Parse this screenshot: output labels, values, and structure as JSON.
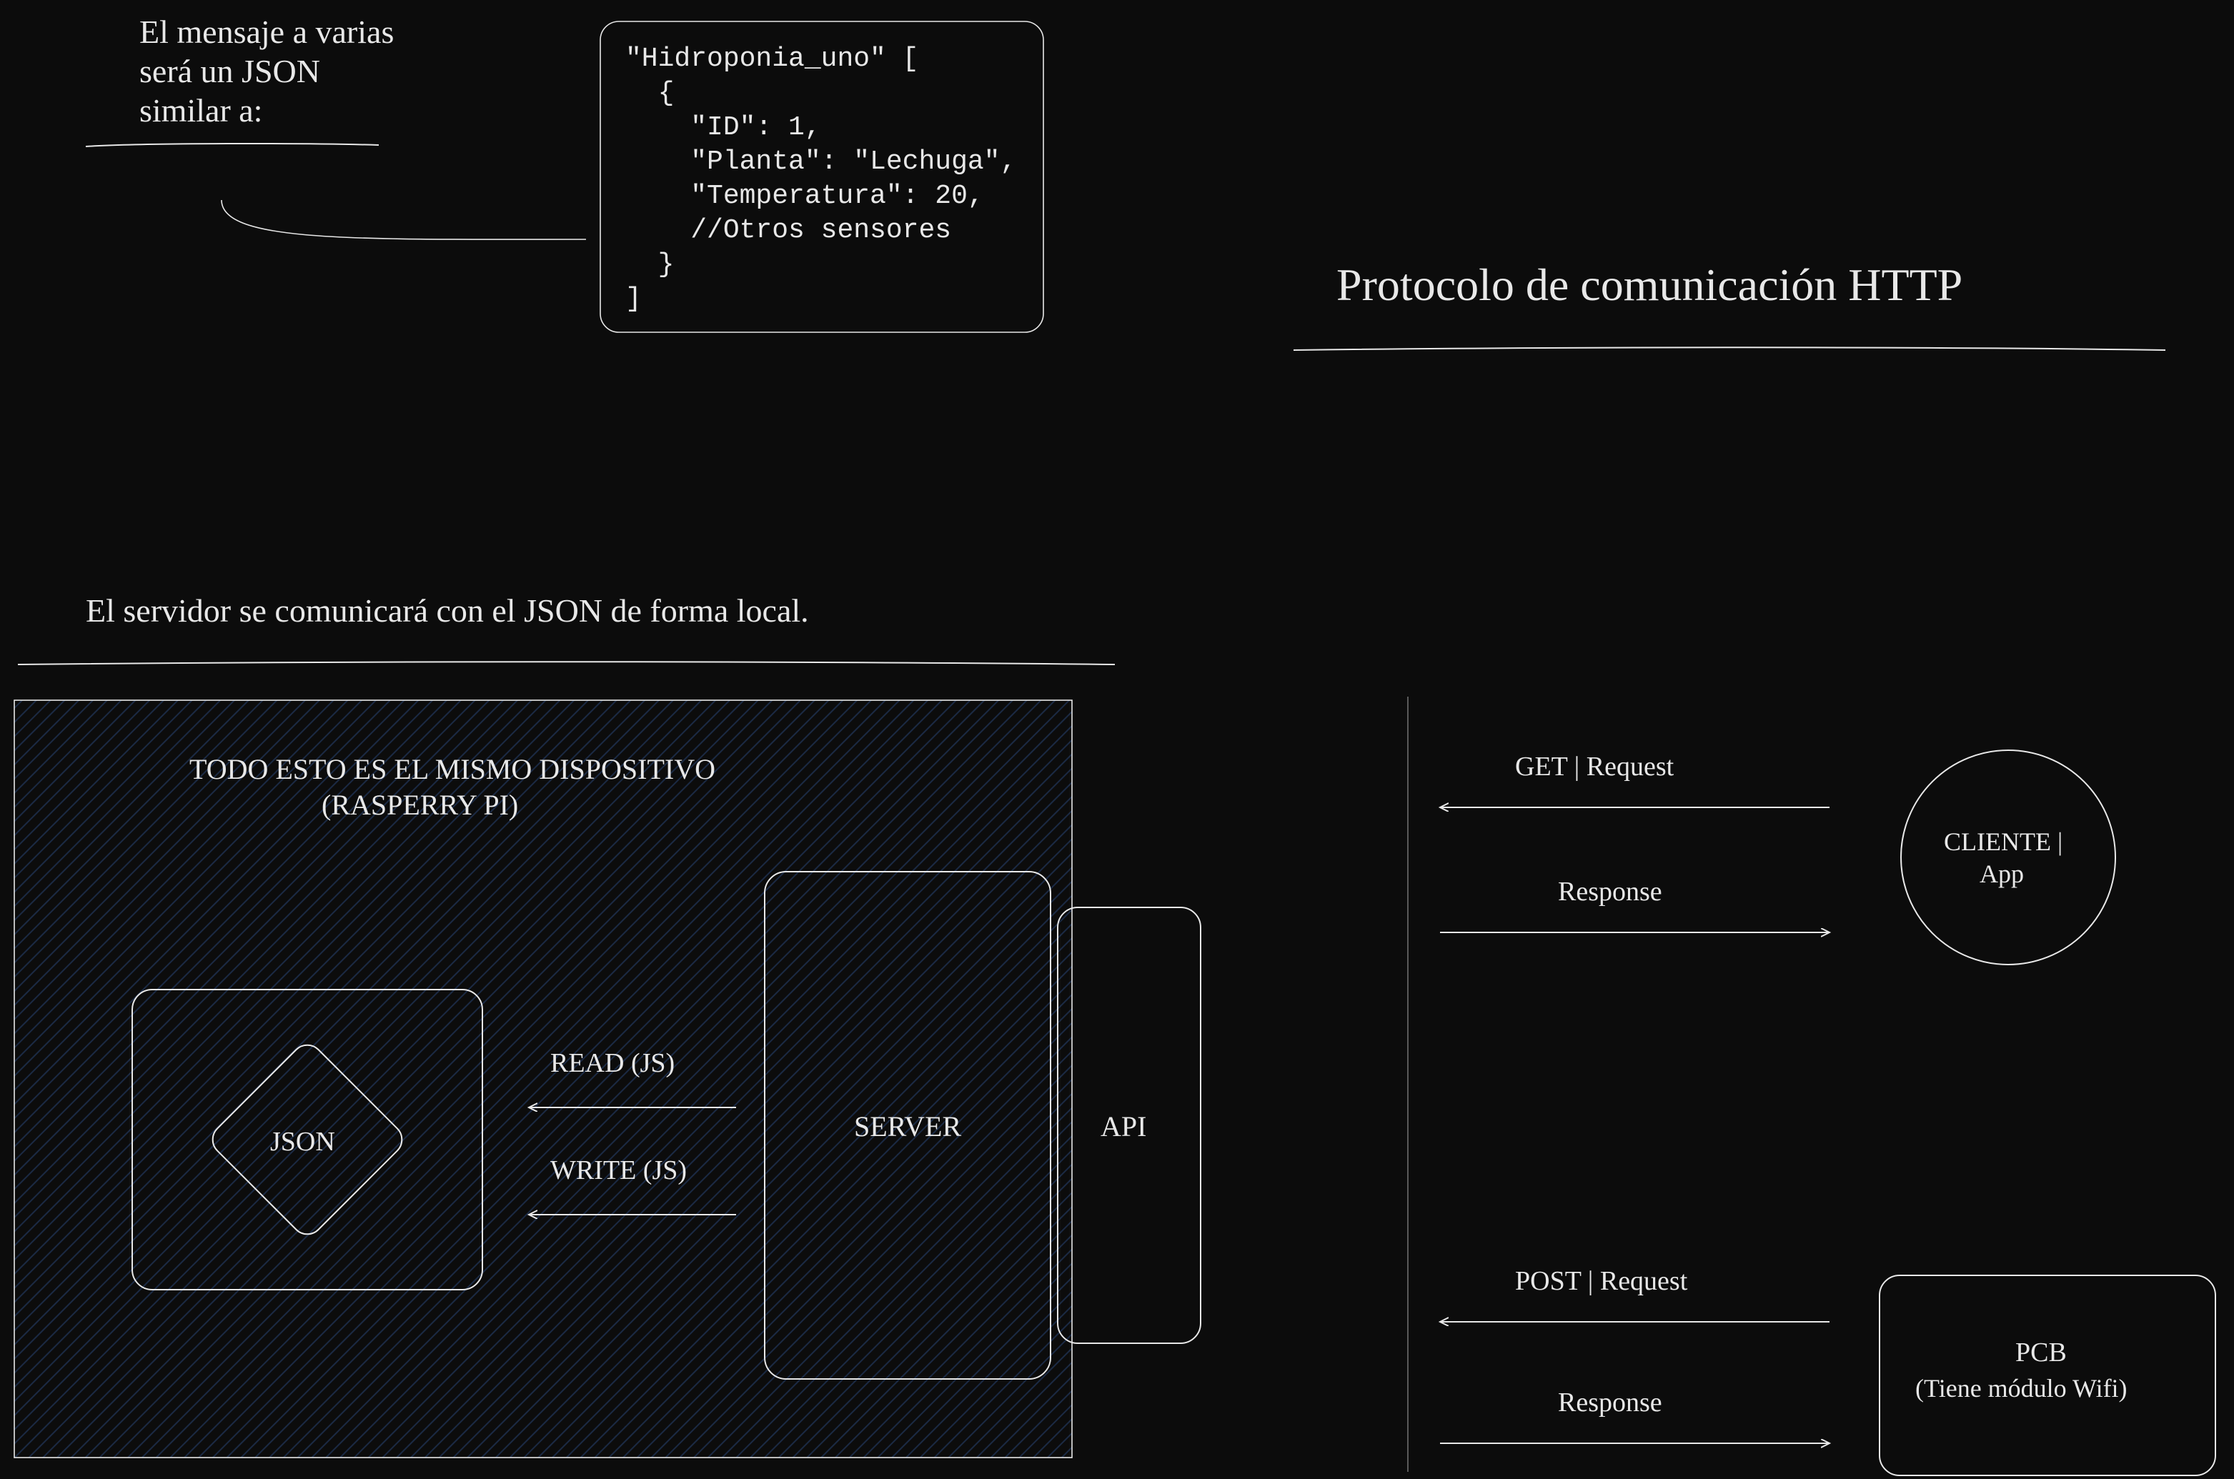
{
  "topLeft": {
    "line1": "El mensaje a varias",
    "line2": "será un JSON",
    "line3": "similar a:"
  },
  "codeBlock": {
    "lines": [
      "\"Hidroponia_uno\" [",
      "  {",
      "    \"ID\": 1,",
      "    \"Planta\": \"Lechuga\",",
      "    \"Temperatura\": 20,",
      "    //Otros sensores",
      "  }",
      "]"
    ]
  },
  "sectionTitle": "Protocolo de comunicación HTTP",
  "midSentence": "El servidor se comunicará con el JSON de forma local.",
  "deviceLabel1": "TODO ESTO ES EL MISMO DISPOSITIVO",
  "deviceLabel2": "(RASPERRY PI)",
  "jsonBox": "JSON",
  "readLabel": "READ (JS)",
  "writeLabel": "WRITE (JS)",
  "serverLabel": "SERVER",
  "apiLabel": "API",
  "getLabel": "GET | Request",
  "responseLabel1": "Response",
  "clienteLine1": "CLIENTE |",
  "clienteLine2": "App",
  "postLabel": "POST | Request",
  "responseLabel2": "Response",
  "pcbLine1": "PCB",
  "pcbLine2": "(Tiene módulo Wifi)"
}
